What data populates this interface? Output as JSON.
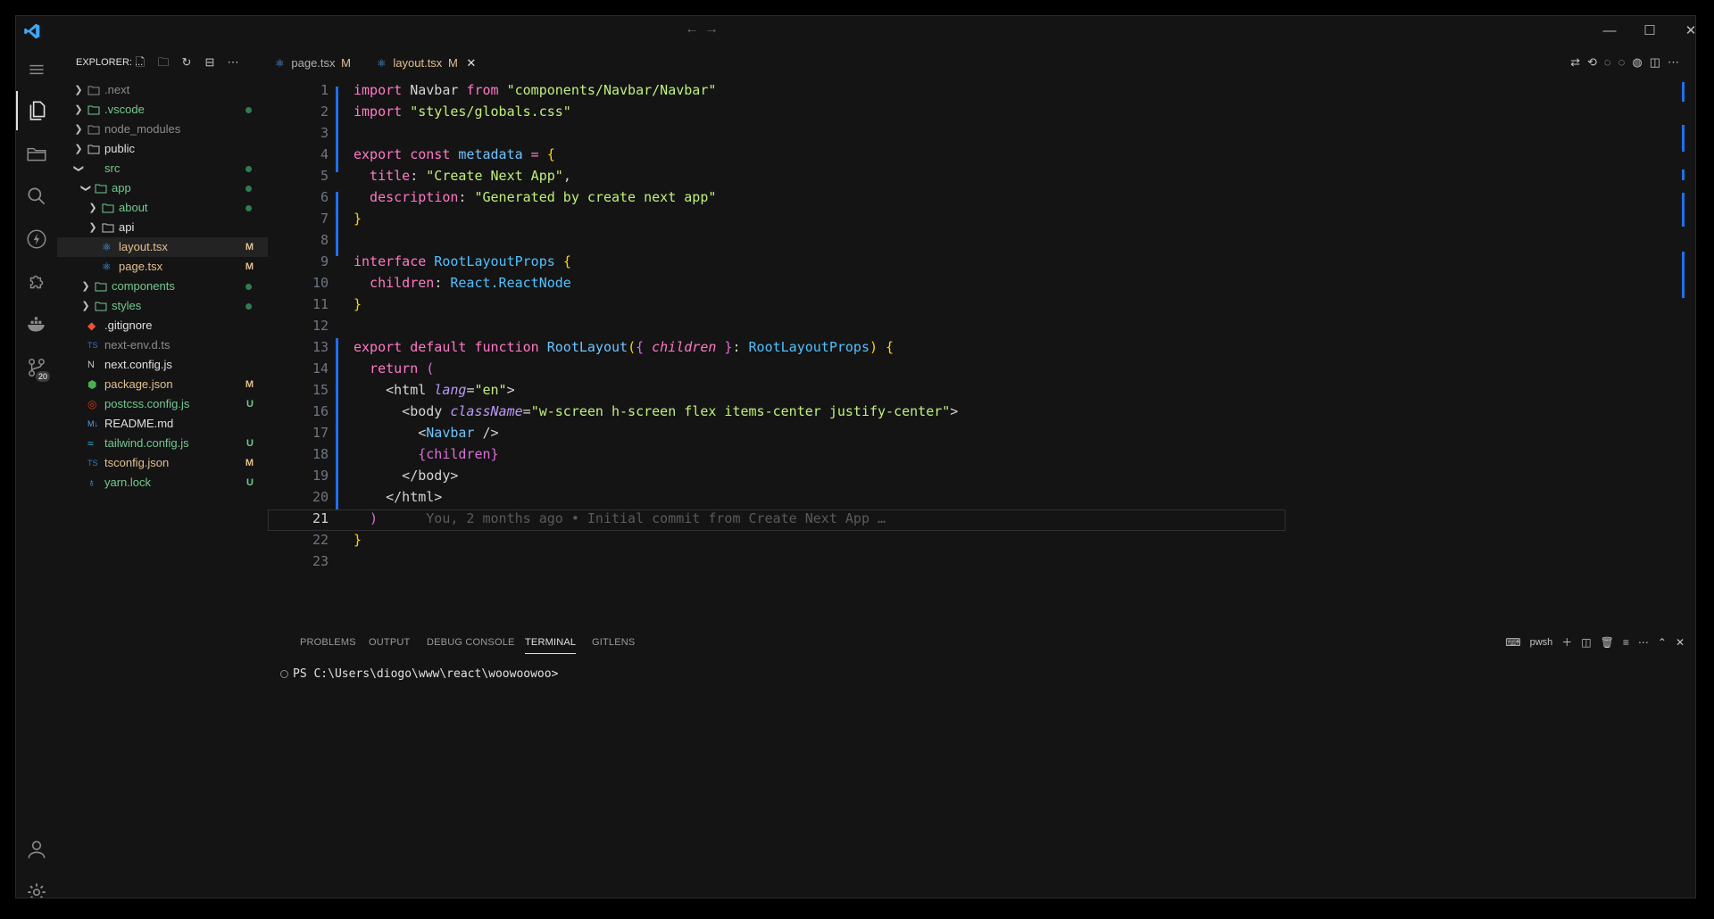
{
  "window": {
    "nav_back": "←",
    "nav_forward": "→",
    "minimize": "—",
    "maximize": "☐",
    "close": "✕"
  },
  "activity_bar": {
    "source_control_badge": "20"
  },
  "sidebar": {
    "title": "EXPLORER: ...",
    "items": [
      {
        "label": ".next",
        "status": ""
      },
      {
        "label": ".vscode",
        "status": "dot"
      },
      {
        "label": "node_modules",
        "status": ""
      },
      {
        "label": "public",
        "status": ""
      },
      {
        "label": "src",
        "status": "dot"
      },
      {
        "label": "app",
        "status": "dot"
      },
      {
        "label": "about",
        "status": "dot"
      },
      {
        "label": "api",
        "status": ""
      },
      {
        "label": "layout.tsx",
        "status": "M"
      },
      {
        "label": "page.tsx",
        "status": "M"
      },
      {
        "label": "components",
        "status": "dot"
      },
      {
        "label": "styles",
        "status": "dot"
      },
      {
        "label": ".gitignore",
        "status": ""
      },
      {
        "label": "next-env.d.ts",
        "status": ""
      },
      {
        "label": "next.config.js",
        "status": ""
      },
      {
        "label": "package.json",
        "status": "M"
      },
      {
        "label": "postcss.config.js",
        "status": "U"
      },
      {
        "label": "README.md",
        "status": ""
      },
      {
        "label": "tailwind.config.js",
        "status": "U"
      },
      {
        "label": "tsconfig.json",
        "status": "M"
      },
      {
        "label": "yarn.lock",
        "status": "U"
      }
    ]
  },
  "tabs": [
    {
      "label": "page.tsx",
      "status": "M"
    },
    {
      "label": "layout.tsx",
      "status": "M",
      "close": "✕"
    }
  ],
  "editor": {
    "line_numbers": [
      "1",
      "2",
      "3",
      "4",
      "5",
      "6",
      "7",
      "8",
      "9",
      "10",
      "11",
      "12",
      "13",
      "14",
      "15",
      "16",
      "17",
      "18",
      "19",
      "20",
      "21",
      "22",
      "23"
    ],
    "code": {
      "l1_import": "import",
      "l1_name": " Navbar ",
      "l1_from": "from",
      "l1_str": " \"components/Navbar/Navbar\"",
      "l2_import": "import",
      "l2_str": " \"styles/globals.css\"",
      "l4_export": "export",
      "l4_const": " const",
      "l4_name": " metadata",
      "l4_eq": " = ",
      "l4_brace": "{",
      "l5_key": "  title",
      "l5_colon": ": ",
      "l5_val": "\"Create Next App\"",
      "l5_comma": ",",
      "l6_key": "  description",
      "l6_colon": ": ",
      "l6_val": "\"Generated by create next app\"",
      "l7_brace": "}",
      "l9_kw": "interface",
      "l9_name": " RootLayoutProps ",
      "l9_brace": "{",
      "l10_key": "  children",
      "l10_colon": ": ",
      "l10_type": "React.ReactNode",
      "l11_brace": "}",
      "l13_export": "export",
      "l13_default": " default",
      "l13_function": " function",
      "l13_name": " RootLayout",
      "l13_paren": "(",
      "l13_brace1": "{ ",
      "l13_param": "children",
      "l13_brace2": " }",
      "l13_colon": ": ",
      "l13_type": "RootLayoutProps",
      "l13_paren2": ")",
      "l13_brace3": " {",
      "l14_return": "  return",
      "l14_paren": " (",
      "l15_open": "    <",
      "l15_tag": "html",
      "l15_attr": " lang",
      "l15_eq": "=",
      "l15_val": "\"en\"",
      "l15_close": ">",
      "l16_open": "      <",
      "l16_tag": "body",
      "l16_attr": " className",
      "l16_eq": "=",
      "l16_val": "\"w-screen h-screen flex items-center justify-center\"",
      "l16_close": ">",
      "l17_open": "        <",
      "l17_tag": "Navbar",
      "l17_close": " />",
      "l18_b1": "        {",
      "l18_children": "children",
      "l18_b2": "}",
      "l19_text": "      </body>",
      "l20_text": "    </html>",
      "l21_paren": "  )",
      "l21_blame": "      You, 2 months ago • Initial commit from Create Next App …",
      "l22_brace": "}"
    }
  },
  "panel": {
    "tabs": [
      "PROBLEMS",
      "OUTPUT",
      "DEBUG CONSOLE",
      "TERMINAL",
      "GITLENS"
    ],
    "shell_label": "pwsh",
    "terminal_prompt": "PS C:\\Users\\diogo\\www\\react\\woowoowoo>"
  },
  "colors": {
    "accent": "#1f6feb",
    "modified": "#e2c08d",
    "untracked": "#73c991",
    "background": "#141414"
  }
}
